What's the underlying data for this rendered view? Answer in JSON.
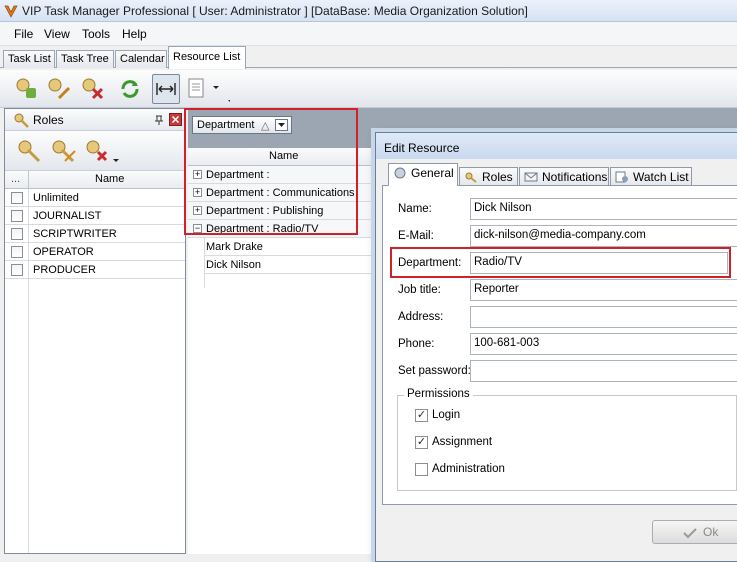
{
  "window": {
    "title": "VIP Task Manager Professional [ User: Administrator ] [DataBase: Media Organization Solution]"
  },
  "menu": [
    {
      "label": "File"
    },
    {
      "label": "View"
    },
    {
      "label": "Tools"
    },
    {
      "label": "Help"
    }
  ],
  "tabs": [
    {
      "label": "Task List"
    },
    {
      "label": "Task Tree"
    },
    {
      "label": "Calendar"
    },
    {
      "label": "Resource List",
      "active": true
    }
  ],
  "roles_panel": {
    "title": "Roles",
    "columns": {
      "ellipsis": "...",
      "name": "Name"
    },
    "rows": [
      {
        "name": "Unlimited"
      },
      {
        "name": "JOURNALIST"
      },
      {
        "name": "SCRIPTWRITER"
      },
      {
        "name": "OPERATOR"
      },
      {
        "name": "PRODUCER"
      }
    ]
  },
  "resource_grid": {
    "group_by": "Department",
    "sort_glyph": "△",
    "column_name": "Name",
    "groups": [
      {
        "label": "Department :",
        "expander": "+"
      },
      {
        "label": "Department : Communications",
        "expander": "+"
      },
      {
        "label": "Department : Publishing",
        "expander": "+"
      },
      {
        "label": "Department : Radio/TV",
        "expander": "−"
      }
    ],
    "resources": [
      {
        "name": "Mark Drake"
      },
      {
        "name": "Dick Nilson"
      }
    ]
  },
  "dialog": {
    "title": "Edit Resource",
    "tabs": [
      {
        "label": "General",
        "active": true,
        "icon": "general-icon"
      },
      {
        "label": "Roles",
        "icon": "roles-icon"
      },
      {
        "label": "Notifications",
        "icon": "notifications-icon"
      },
      {
        "label": "Watch List",
        "icon": "watch-list-icon"
      }
    ],
    "fields": {
      "name": {
        "label": "Name:",
        "value": "Dick Nilson"
      },
      "email": {
        "label": "E-Mail:",
        "value": "dick-nilson@media-company.com"
      },
      "department": {
        "label": "Department:",
        "value": "Radio/TV"
      },
      "job_title": {
        "label": "Job title:",
        "value": "Reporter"
      },
      "address": {
        "label": "Address:",
        "value": ""
      },
      "phone": {
        "label": "Phone:",
        "value": "100-681-003"
      },
      "password": {
        "label": "Set password:",
        "value": ""
      }
    },
    "permissions": {
      "legend": "Permissions",
      "login": {
        "label": "Login",
        "checked": true,
        "mark": "✓"
      },
      "assignment": {
        "label": "Assignment",
        "checked": true,
        "mark": "✓"
      },
      "administration": {
        "label": "Administration",
        "checked": false,
        "mark": ""
      }
    },
    "ok_label": "Ok"
  },
  "colors": {
    "highlight": "#d0202a",
    "group_bar": "#9ca6b2"
  }
}
